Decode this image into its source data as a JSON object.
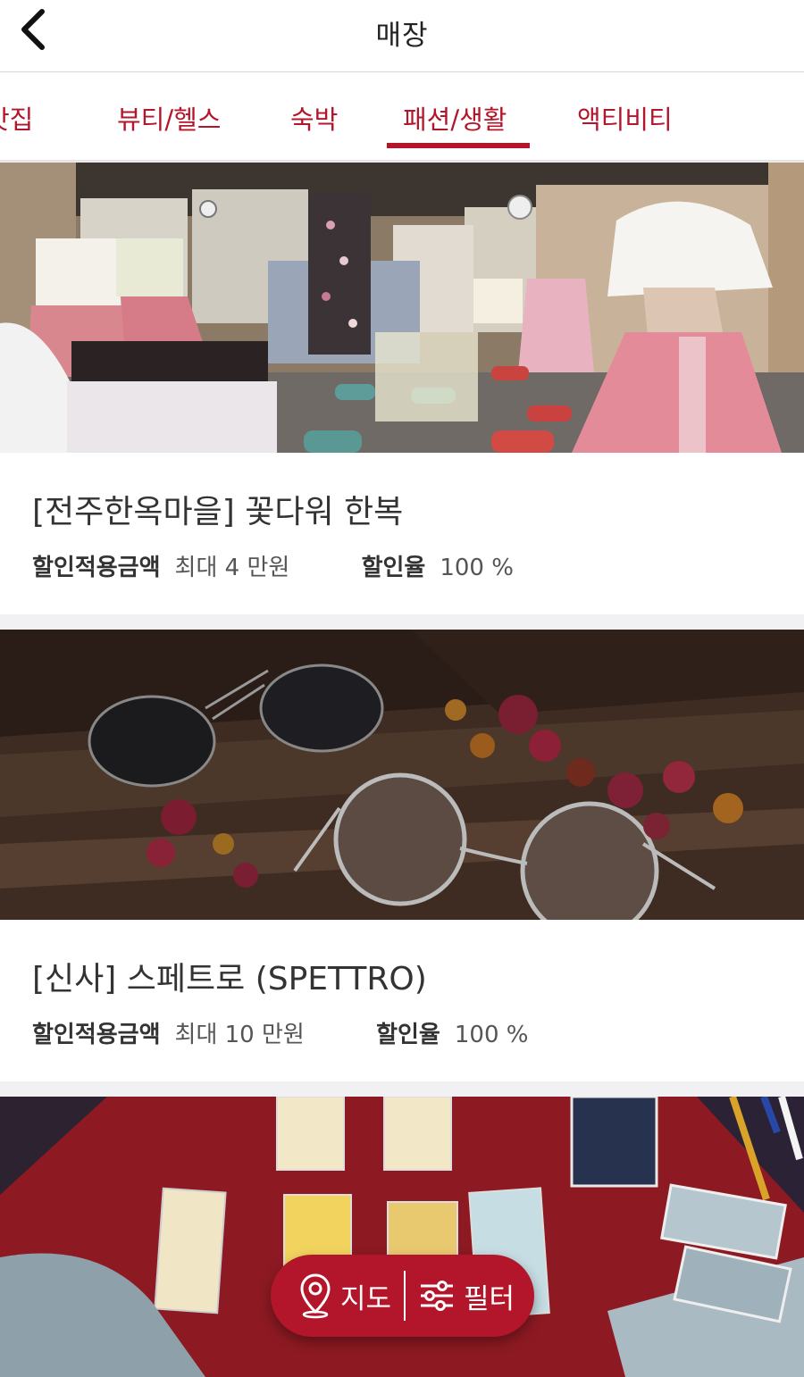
{
  "header": {
    "title": "매장",
    "back_icon": "chevron-left-icon"
  },
  "tabs": [
    {
      "label": "맛집",
      "active": false
    },
    {
      "label": "뷰티/헬스",
      "active": false
    },
    {
      "label": "숙박",
      "active": false
    },
    {
      "label": "패션/생활",
      "active": true
    },
    {
      "label": "액티비티",
      "active": false
    }
  ],
  "stores": [
    {
      "name": "[전주한옥마을] 꽃다워 한복",
      "discount_amount_label": "할인적용금액",
      "discount_amount_value": "최대 4 만원",
      "discount_rate_label": "할인율",
      "discount_rate_value": "100 %"
    },
    {
      "name": "[신사] 스페트로 (SPETTRO)",
      "discount_amount_label": "할인적용금액",
      "discount_amount_value": "최대 10 만원",
      "discount_rate_label": "할인율",
      "discount_rate_value": "100 %"
    }
  ],
  "floating_bar": {
    "map_label": "지도",
    "map_icon": "map-pin-icon",
    "filter_label": "필터",
    "filter_icon": "sliders-icon"
  },
  "colors": {
    "accent": "#b3162b",
    "background": "#f1f1f3"
  }
}
